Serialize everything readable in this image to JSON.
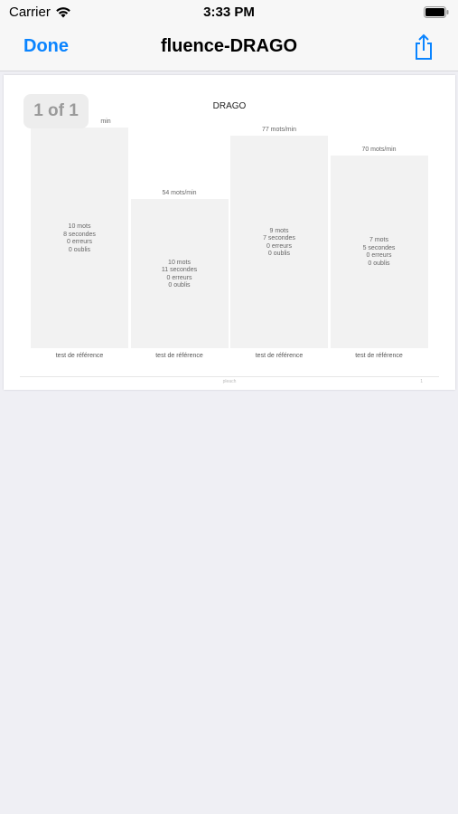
{
  "status_bar": {
    "carrier": "Carrier",
    "time": "3:33 PM"
  },
  "nav": {
    "done_label": "Done",
    "title": "fluence-DRAGO"
  },
  "document": {
    "page_indicator": "1 of 1",
    "footer_text": "pleach",
    "footer_mark": "1"
  },
  "chart_data": {
    "type": "bar",
    "title": "DRAGO",
    "categories": [
      "test de référence",
      "test de référence",
      "test de référence",
      "test de référence"
    ],
    "values": [
      80,
      54,
      77,
      70
    ],
    "top_labels": [
      "min",
      "54 mots/min",
      "77 mots/min",
      "70 mots/min"
    ],
    "details": [
      [
        "10 mots",
        "8 secondes",
        "0 erreurs",
        "0 oublis"
      ],
      [
        "10 mots",
        "11 secondes",
        "0 erreurs",
        "0 oublis"
      ],
      [
        "9 mots",
        "7 secondes",
        "0 erreurs",
        "0 oublis"
      ],
      [
        "7 mots",
        "5 secondes",
        "0 erreurs",
        "0 oublis"
      ]
    ],
    "ylim": [
      0,
      82
    ]
  }
}
